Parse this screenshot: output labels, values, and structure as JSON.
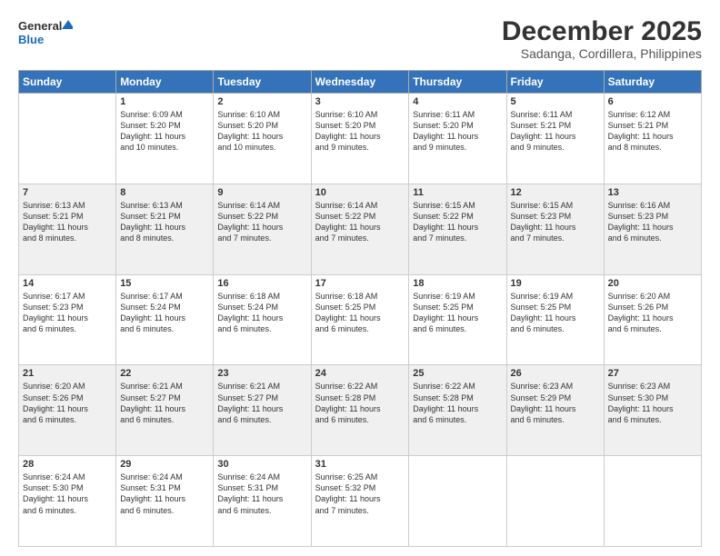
{
  "header": {
    "logo_line1": "General",
    "logo_line2": "Blue",
    "month": "December 2025",
    "location": "Sadanga, Cordillera, Philippines"
  },
  "days_of_week": [
    "Sunday",
    "Monday",
    "Tuesday",
    "Wednesday",
    "Thursday",
    "Friday",
    "Saturday"
  ],
  "weeks": [
    [
      {
        "day": "",
        "info": ""
      },
      {
        "day": "1",
        "info": "Sunrise: 6:09 AM\nSunset: 5:20 PM\nDaylight: 11 hours\nand 10 minutes."
      },
      {
        "day": "2",
        "info": "Sunrise: 6:10 AM\nSunset: 5:20 PM\nDaylight: 11 hours\nand 10 minutes."
      },
      {
        "day": "3",
        "info": "Sunrise: 6:10 AM\nSunset: 5:20 PM\nDaylight: 11 hours\nand 9 minutes."
      },
      {
        "day": "4",
        "info": "Sunrise: 6:11 AM\nSunset: 5:20 PM\nDaylight: 11 hours\nand 9 minutes."
      },
      {
        "day": "5",
        "info": "Sunrise: 6:11 AM\nSunset: 5:21 PM\nDaylight: 11 hours\nand 9 minutes."
      },
      {
        "day": "6",
        "info": "Sunrise: 6:12 AM\nSunset: 5:21 PM\nDaylight: 11 hours\nand 8 minutes."
      }
    ],
    [
      {
        "day": "7",
        "info": "Sunrise: 6:13 AM\nSunset: 5:21 PM\nDaylight: 11 hours\nand 8 minutes."
      },
      {
        "day": "8",
        "info": "Sunrise: 6:13 AM\nSunset: 5:21 PM\nDaylight: 11 hours\nand 8 minutes."
      },
      {
        "day": "9",
        "info": "Sunrise: 6:14 AM\nSunset: 5:22 PM\nDaylight: 11 hours\nand 7 minutes."
      },
      {
        "day": "10",
        "info": "Sunrise: 6:14 AM\nSunset: 5:22 PM\nDaylight: 11 hours\nand 7 minutes."
      },
      {
        "day": "11",
        "info": "Sunrise: 6:15 AM\nSunset: 5:22 PM\nDaylight: 11 hours\nand 7 minutes."
      },
      {
        "day": "12",
        "info": "Sunrise: 6:15 AM\nSunset: 5:23 PM\nDaylight: 11 hours\nand 7 minutes."
      },
      {
        "day": "13",
        "info": "Sunrise: 6:16 AM\nSunset: 5:23 PM\nDaylight: 11 hours\nand 6 minutes."
      }
    ],
    [
      {
        "day": "14",
        "info": "Sunrise: 6:17 AM\nSunset: 5:23 PM\nDaylight: 11 hours\nand 6 minutes."
      },
      {
        "day": "15",
        "info": "Sunrise: 6:17 AM\nSunset: 5:24 PM\nDaylight: 11 hours\nand 6 minutes."
      },
      {
        "day": "16",
        "info": "Sunrise: 6:18 AM\nSunset: 5:24 PM\nDaylight: 11 hours\nand 6 minutes."
      },
      {
        "day": "17",
        "info": "Sunrise: 6:18 AM\nSunset: 5:25 PM\nDaylight: 11 hours\nand 6 minutes."
      },
      {
        "day": "18",
        "info": "Sunrise: 6:19 AM\nSunset: 5:25 PM\nDaylight: 11 hours\nand 6 minutes."
      },
      {
        "day": "19",
        "info": "Sunrise: 6:19 AM\nSunset: 5:25 PM\nDaylight: 11 hours\nand 6 minutes."
      },
      {
        "day": "20",
        "info": "Sunrise: 6:20 AM\nSunset: 5:26 PM\nDaylight: 11 hours\nand 6 minutes."
      }
    ],
    [
      {
        "day": "21",
        "info": "Sunrise: 6:20 AM\nSunset: 5:26 PM\nDaylight: 11 hours\nand 6 minutes."
      },
      {
        "day": "22",
        "info": "Sunrise: 6:21 AM\nSunset: 5:27 PM\nDaylight: 11 hours\nand 6 minutes."
      },
      {
        "day": "23",
        "info": "Sunrise: 6:21 AM\nSunset: 5:27 PM\nDaylight: 11 hours\nand 6 minutes."
      },
      {
        "day": "24",
        "info": "Sunrise: 6:22 AM\nSunset: 5:28 PM\nDaylight: 11 hours\nand 6 minutes."
      },
      {
        "day": "25",
        "info": "Sunrise: 6:22 AM\nSunset: 5:28 PM\nDaylight: 11 hours\nand 6 minutes."
      },
      {
        "day": "26",
        "info": "Sunrise: 6:23 AM\nSunset: 5:29 PM\nDaylight: 11 hours\nand 6 minutes."
      },
      {
        "day": "27",
        "info": "Sunrise: 6:23 AM\nSunset: 5:30 PM\nDaylight: 11 hours\nand 6 minutes."
      }
    ],
    [
      {
        "day": "28",
        "info": "Sunrise: 6:24 AM\nSunset: 5:30 PM\nDaylight: 11 hours\nand 6 minutes."
      },
      {
        "day": "29",
        "info": "Sunrise: 6:24 AM\nSunset: 5:31 PM\nDaylight: 11 hours\nand 6 minutes."
      },
      {
        "day": "30",
        "info": "Sunrise: 6:24 AM\nSunset: 5:31 PM\nDaylight: 11 hours\nand 6 minutes."
      },
      {
        "day": "31",
        "info": "Sunrise: 6:25 AM\nSunset: 5:32 PM\nDaylight: 11 hours\nand 7 minutes."
      },
      {
        "day": "",
        "info": ""
      },
      {
        "day": "",
        "info": ""
      },
      {
        "day": "",
        "info": ""
      }
    ]
  ]
}
